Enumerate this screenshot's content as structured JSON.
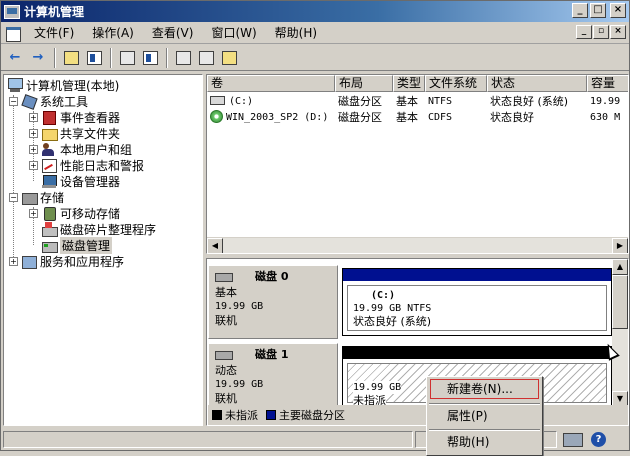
{
  "window": {
    "title": "计算机管理"
  },
  "menu": [
    "文件(F)",
    "操作(A)",
    "查看(V)",
    "窗口(W)",
    "帮助(H)"
  ],
  "title_buttons": [
    "_",
    "□",
    "×"
  ],
  "mdi_buttons": [
    "_",
    "▫",
    "×"
  ],
  "toolbar": {
    "back_glyph": "←",
    "forward_glyph": "→"
  },
  "tree": {
    "root": "计算机管理(本地)",
    "system_tools": "系统工具",
    "event_viewer": "事件查看器",
    "shared_folders": "共享文件夹",
    "local_users": "本地用户和组",
    "perf_logs": "性能日志和警报",
    "device_manager": "设备管理器",
    "storage": "存储",
    "removable_storage": "可移动存储",
    "defrag": "磁盘碎片整理程序",
    "disk_management": "磁盘管理",
    "services_apps": "服务和应用程序",
    "expander_minus": "−",
    "expander_plus": "+"
  },
  "volumes": {
    "columns": [
      "卷",
      "布局",
      "类型",
      "文件系统",
      "状态",
      "容量"
    ],
    "rows": [
      {
        "name": "(C:)",
        "layout": "磁盘分区",
        "type": "基本",
        "fs": "NTFS",
        "status": "状态良好 (系统)",
        "capacity": "19.99"
      },
      {
        "name": "WIN_2003_SP2 (D:)",
        "layout": "磁盘分区",
        "type": "基本",
        "fs": "CDFS",
        "status": "状态良好",
        "capacity": "630 M"
      }
    ]
  },
  "disks": [
    {
      "name": "磁盘 0",
      "kind": "基本",
      "size": "19.99 GB",
      "state": "联机",
      "partition": {
        "label": "(C:)",
        "detail": "19.99 GB NTFS",
        "status": "状态良好 (系统)"
      }
    },
    {
      "name": "磁盘 1",
      "kind": "动态",
      "size": "19.99 GB",
      "state": "联机",
      "partition": {
        "label": "",
        "detail": "19.99 GB",
        "status": "未指派"
      }
    }
  ],
  "legend": {
    "unallocated": "未指派",
    "primary": "主要磁盘分区"
  },
  "colors": {
    "primary_partition": "#001090",
    "unallocated": "#000000"
  },
  "context_menu": [
    "新建卷(N)...",
    "属性(P)",
    "帮助(H)"
  ],
  "scroll_glyphs": {
    "left": "◀",
    "right": "▶",
    "up": "▲",
    "down": "▼"
  }
}
